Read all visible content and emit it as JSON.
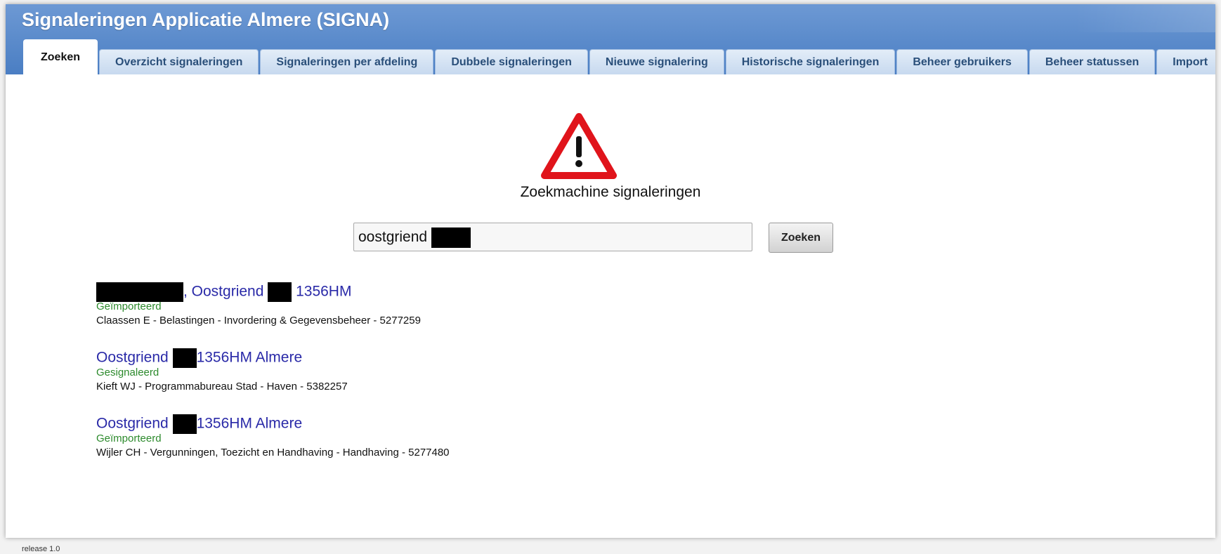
{
  "app": {
    "title": "Signaleringen Applicatie Almere (SIGNA)"
  },
  "tabs": [
    {
      "label": "Zoeken",
      "active": true
    },
    {
      "label": "Overzicht signaleringen",
      "active": false
    },
    {
      "label": "Signaleringen per afdeling",
      "active": false
    },
    {
      "label": "Dubbele signaleringen",
      "active": false
    },
    {
      "label": "Nieuwe signalering",
      "active": false
    },
    {
      "label": "Historische signaleringen",
      "active": false
    },
    {
      "label": "Beheer gebruikers",
      "active": false
    },
    {
      "label": "Beheer statussen",
      "active": false
    },
    {
      "label": "Import",
      "active": false
    }
  ],
  "search": {
    "title": "Zoekmachine signaleringen",
    "value": "oostgriend",
    "button_label": "Zoeken"
  },
  "results": [
    {
      "parts": [
        ", Oostgriend",
        "1356HM"
      ],
      "status": "Geïmporteerd",
      "meta": "Claassen E - Belastingen - Invordering & Gegevensbeheer - 5277259"
    },
    {
      "parts": [
        "Oostgriend",
        "1356HM Almere"
      ],
      "status": "Gesignaleerd",
      "meta": "Kieft WJ - Programmabureau Stad - Haven - 5382257"
    },
    {
      "parts": [
        "Oostgriend",
        "1356HM Almere"
      ],
      "status": "Geïmporteerd",
      "meta": "Wijler CH - Vergunningen, Toezicht en Handhaving - Handhaving - 5277480"
    }
  ],
  "footer": {
    "release": "release 1.0"
  },
  "colors": {
    "header": "#4a7ec3",
    "link": "#2a2aa8",
    "status_green": "#2c8a2c",
    "warning_red": "#e0141b"
  },
  "icons": {
    "warning": "warning-triangle-icon"
  }
}
